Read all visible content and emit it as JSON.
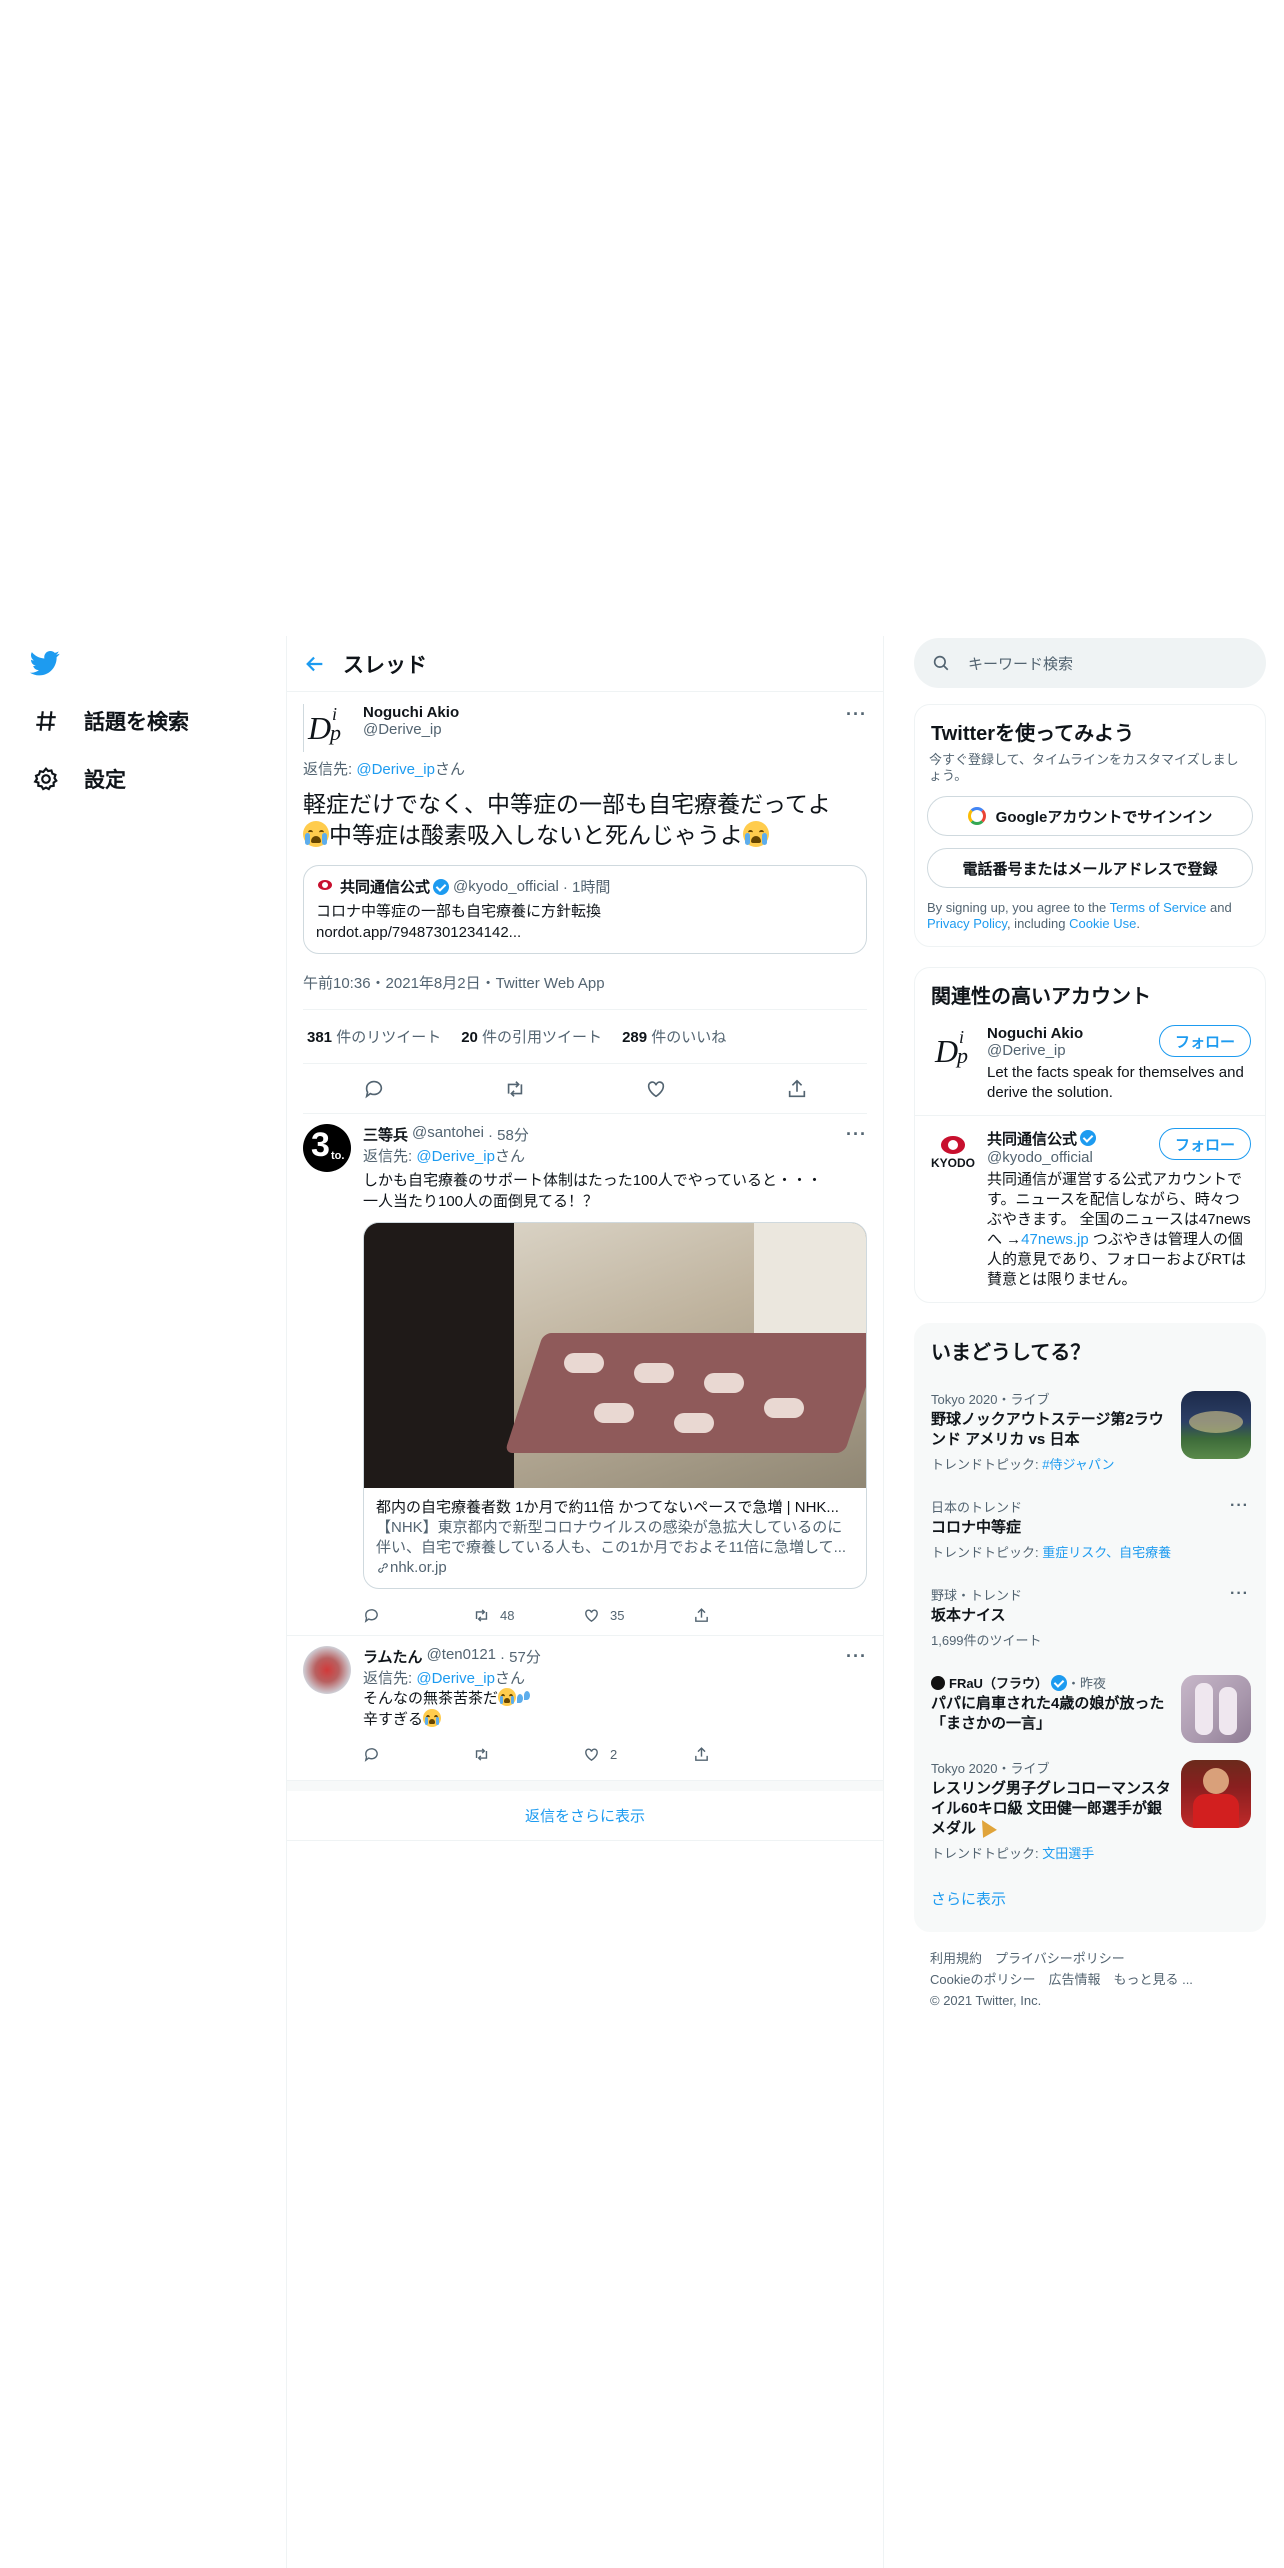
{
  "nav": {
    "explore_label": "話題を検索",
    "settings_label": "設定"
  },
  "header": {
    "title": "スレッド"
  },
  "main_tweet": {
    "name": "Noguchi Akio",
    "handle": "@Derive_ip",
    "reply_prefix": "返信先: ",
    "reply_handle": "@Derive_ip",
    "reply_suffix": "さん",
    "text_line1": "軽症だけでなく、中等症の一部も自宅療養だってよ",
    "text_line2": "中等症は酸素吸入しないと死んじゃうよ",
    "quote": {
      "name": "共同通信公式",
      "handle": "@kyodo_official",
      "time": "· 1時間",
      "text_line1": "コロナ中等症の一部も自宅療養に方針転換",
      "text_line2": "nordot.app/79487301234142..."
    },
    "meta": "午前10:36・2021年8月2日・Twitter Web App",
    "retweets": "381",
    "retweets_label": " 件のリツイート",
    "quotes": "20",
    "quotes_label": " 件の引用ツイート",
    "likes": "289",
    "likes_label": " 件のいいね"
  },
  "replies": [
    {
      "name": "三等兵",
      "handle": "@santohei",
      "time": "· 58分",
      "reply_prefix": "返信先: ",
      "reply_handle": "@Derive_ip",
      "reply_suffix": "さん",
      "text_line1": "しかも自宅療養のサポート体制はたった100人でやっていると・・・",
      "text_line2": "一人当たり100人の面倒見てる！？",
      "card_title": "都内の自宅療養者数 1か月で約11倍 かつてないペースで急増 | NHK...",
      "card_desc": "【NHK】東京都内で新型コロナウイルスの感染が急拡大しているのに伴い、自宅で療養している人も、この1か月でおよそ11倍に急増して...",
      "card_domain": "nhk.or.jp",
      "retweet_count": "48",
      "like_count": "35"
    },
    {
      "name": "ラムたん",
      "handle": "@ten0121",
      "time": "· 57分",
      "reply_prefix": "返信先: ",
      "reply_handle": "@Derive_ip",
      "reply_suffix": "さん",
      "text_line1": "そんなの無茶苦茶だ",
      "text_line2": "辛すぎる",
      "like_count": "2"
    }
  ],
  "show_more_replies": "返信をさらに表示",
  "search": {
    "placeholder": "キーワード検索"
  },
  "signup": {
    "title": "Twitterを使ってみよう",
    "subtitle": "今すぐ登録して、タイムラインをカスタマイズしましょう。",
    "google_btn": "Googleアカウントでサインイン",
    "phone_btn": "電話番号またはメールアドレスで登録",
    "terms_pre": "By signing up, you agree to the ",
    "terms_link": "Terms of Service",
    "terms_mid": " and ",
    "privacy_link": "Privacy Policy",
    "terms_mid2": ", including ",
    "cookie_link": "Cookie Use",
    "terms_end": "."
  },
  "related": {
    "title": "関連性の高いアカウント",
    "follow_label": "フォロー",
    "accounts": [
      {
        "name": "Noguchi Akio",
        "handle": "@Derive_ip",
        "bio": "Let the facts speak for themselves and derive the solution."
      },
      {
        "name": "共同通信公式",
        "handle": "@kyodo_official",
        "bio_pre": "共同通信が運営する公式アカウントです。ニュースを配信しながら、時々つぶやきます。 全国のニュースは47newsへ →",
        "bio_link": "47news.jp",
        "bio_post": " つぶやきは管理人の個人的意見であり、フォローおよびRTは賛意とは限りません。"
      }
    ]
  },
  "trends": {
    "title": "いまどうしてる？",
    "items": [
      {
        "ctx": "Tokyo 2020・ライブ",
        "title": "野球ノックアウトステージ第2ラウンド アメリカ vs 日本",
        "sub_pre": "トレンドトピック: ",
        "sub_link": "#侍ジャパン"
      },
      {
        "ctx": "日本のトレンド",
        "title": "コロナ中等症",
        "sub_pre": "トレンドトピック: ",
        "sub_link": "重症リスク、自宅療養"
      },
      {
        "ctx": "野球・トレンド",
        "title": "坂本ナイス",
        "sub_plain": "1,699件のツイート"
      },
      {
        "ctx_name": "FRaU（フラウ）",
        "ctx_time": "・昨夜",
        "title": "パパに肩車された4歳の娘が放った「まさかの一言」"
      },
      {
        "ctx": "Tokyo 2020・ライブ",
        "title": "レスリング男子グレコローマンスタイル60キロ級 文田健一郎選手が銀メダル",
        "sub_pre": "トレンドトピック: ",
        "sub_link": "文田選手"
      }
    ],
    "show_more": "さらに表示"
  },
  "footer": {
    "line1": "利用規約　プライバシーポリシー",
    "line2": "Cookieのポリシー　広告情報　もっと見る ...",
    "line3": "© 2021 Twitter, Inc."
  },
  "colors": {
    "accent": "#1d9bf0",
    "text": "#0f1419",
    "muted": "#536471"
  }
}
